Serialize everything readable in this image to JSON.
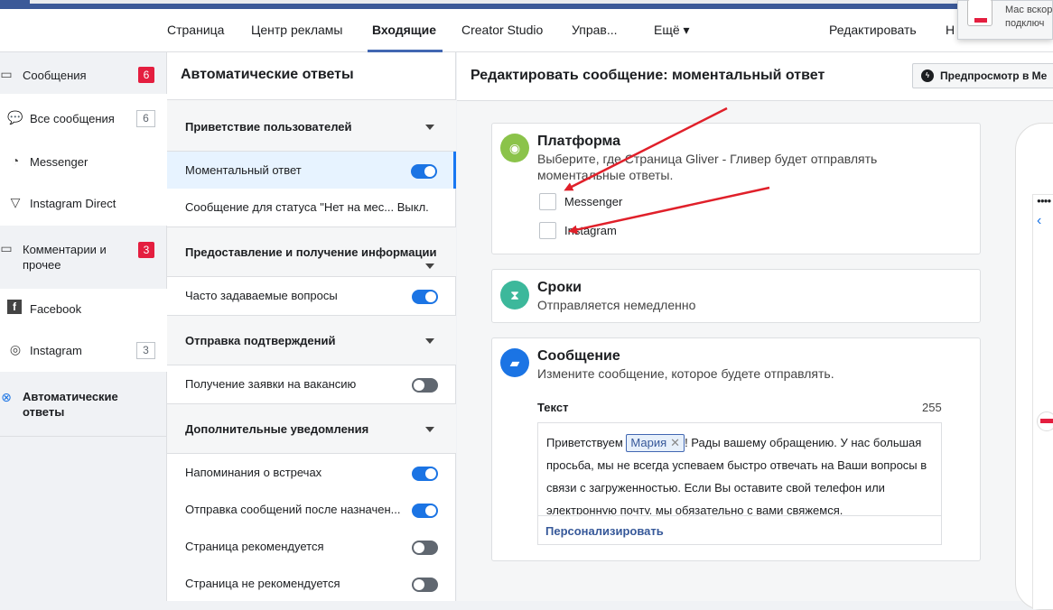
{
  "nav": {
    "items": [
      "Страница",
      "Центр рекламы",
      "Входящие",
      "Creator Studio",
      "Управ...",
      "Ещё ▾"
    ],
    "right": [
      "Редактировать",
      "Н"
    ],
    "notification": [
      "Мас вскор",
      "подключ"
    ]
  },
  "sidebar": {
    "items": [
      {
        "label": "Сообщения",
        "badge": "6"
      },
      {
        "label": "Все сообщения",
        "badge": "6"
      },
      {
        "label": "Messenger"
      },
      {
        "label": "Instagram Direct"
      },
      {
        "label": "Комментарии и прочее",
        "badge": "3"
      },
      {
        "label": "Facebook"
      },
      {
        "label": "Instagram",
        "badge": "3"
      },
      {
        "label": "Автоматические ответы"
      }
    ]
  },
  "panel": {
    "title": "Автоматические ответы",
    "sections": [
      "Приветствие пользователей",
      "Предоставление и получение информации",
      "Отправка подтверждений",
      "Дополнительные уведомления"
    ],
    "rows": [
      {
        "label": "Моментальный ответ",
        "on": true
      },
      {
        "label": "Сообщение для статуса \"Нет на мес... Выкл."
      },
      {
        "label": "Часто задаваемые вопросы",
        "on": true
      },
      {
        "label": "Получение заявки на вакансию",
        "on": false
      },
      {
        "label": "Напоминания о встречах",
        "on": true
      },
      {
        "label": "Отправка сообщений после назначен...",
        "on": true
      },
      {
        "label": "Страница рекомендуется",
        "on": false
      },
      {
        "label": "Страница не рекомендуется",
        "on": false
      }
    ]
  },
  "main": {
    "title": "Редактировать сообщение: моментальный ответ",
    "preview_label": "Предпросмотр в Me",
    "platform": {
      "title": "Платформа",
      "subtitle": "Выберите, где Страница Gliver - Гливер будет отправлять моментальные ответы.",
      "options": [
        "Messenger",
        "Instagram"
      ]
    },
    "timing": {
      "title": "Сроки",
      "subtitle": "Отправляется немедленно"
    },
    "message": {
      "title": "Сообщение",
      "subtitle": "Измените сообщение, которое будете отправлять.",
      "text_label": "Текст",
      "char_count": "255",
      "text_before": "Приветствуем ",
      "chip": "Мария",
      "text_after": "! Рады вашему обращению. У нас большая просьба, мы не всегда успеваем быстро отвечать на Ваши вопросы в связи с загруженностью. Если Вы оставите свой телефон или электронную почту, мы обязательно с вами свяжемся.",
      "personalize": "Персонализировать"
    }
  },
  "colors": {
    "accent": "#1b74e4",
    "badge": "#e41e3f",
    "arrow": "#e0202a"
  }
}
